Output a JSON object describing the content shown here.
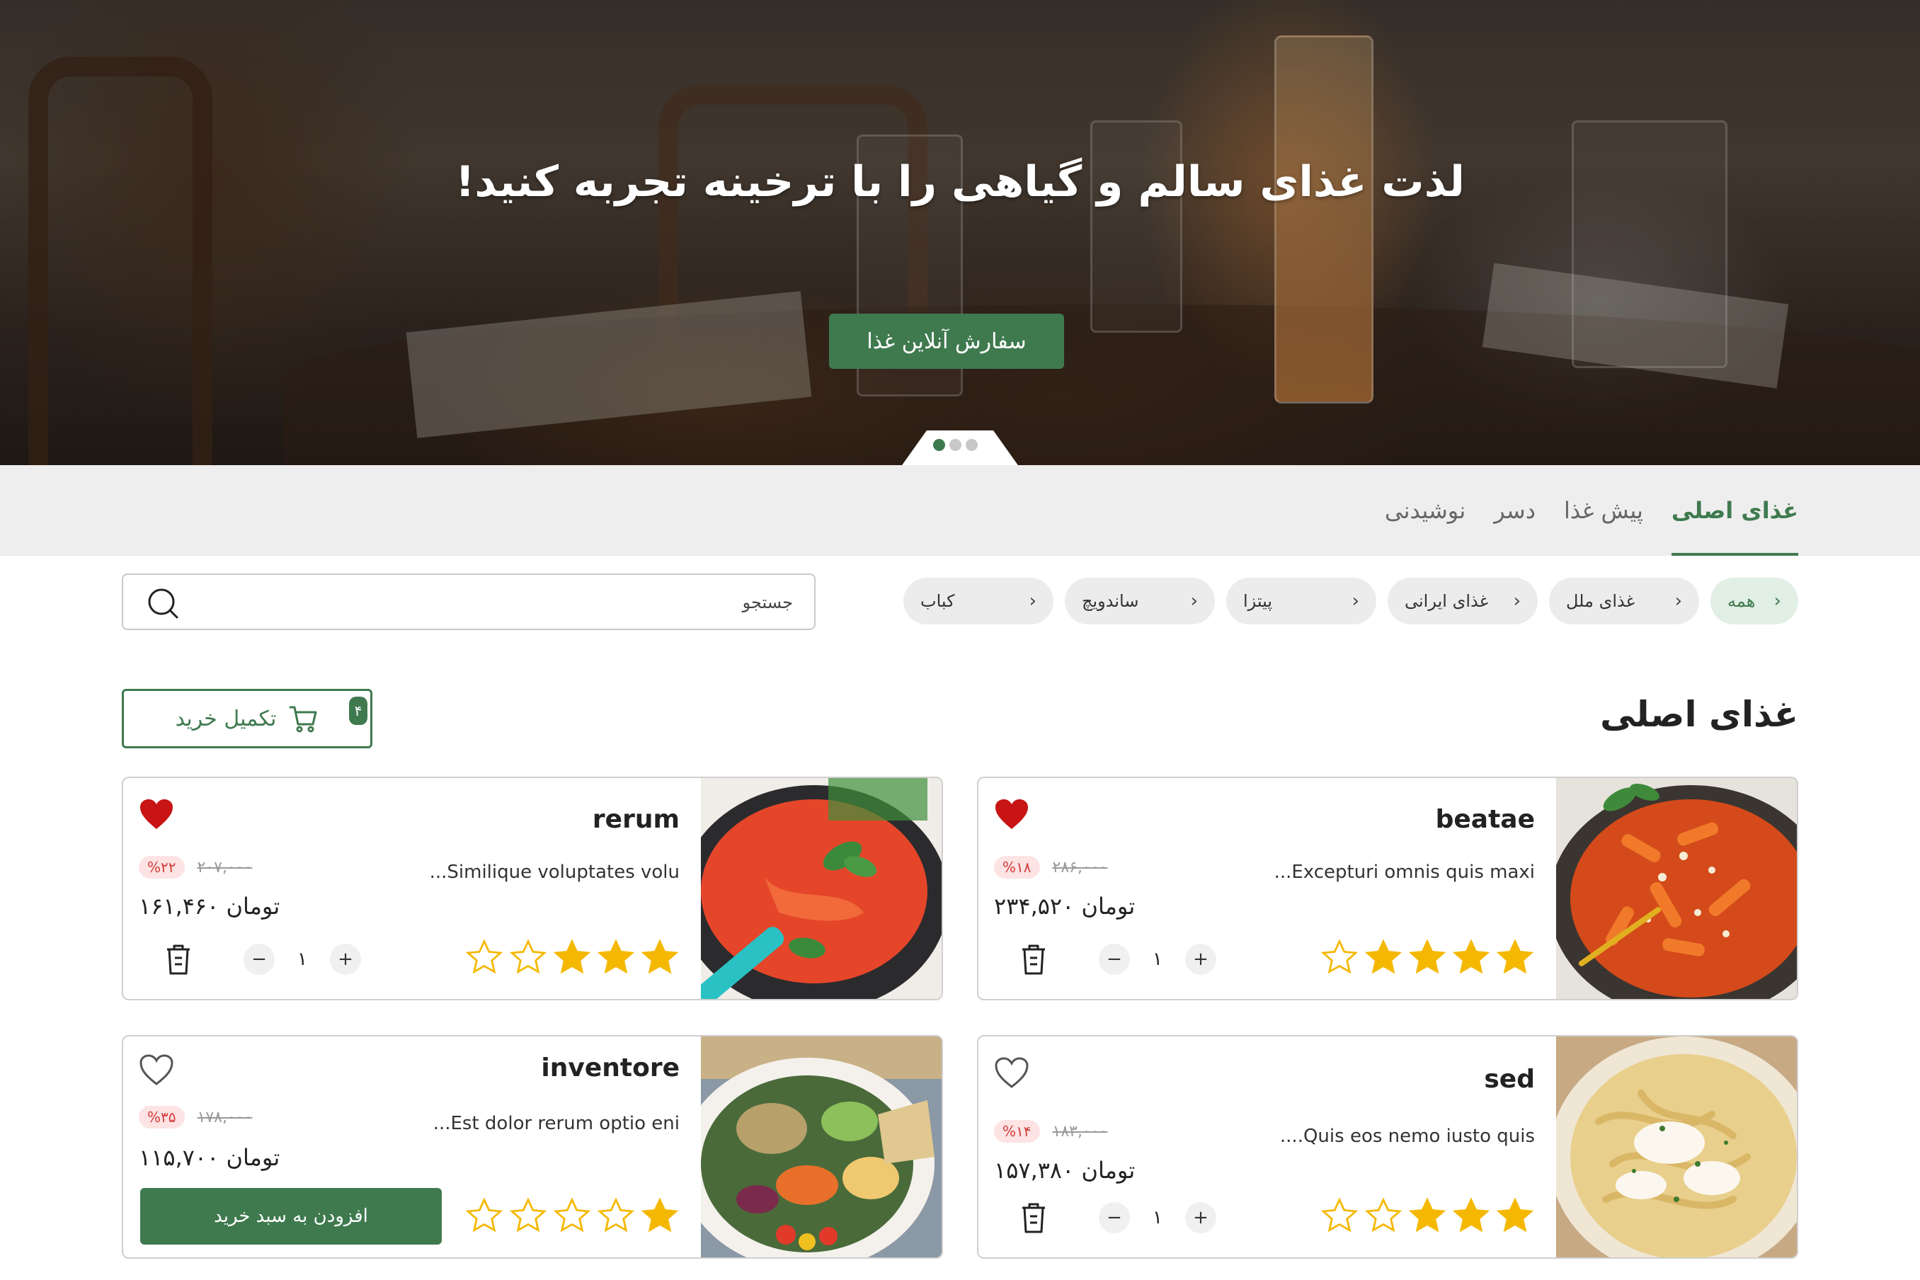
{
  "hero": {
    "title": "لذت غذای سالم و گیاهی را با ترخینه تجربه کنید!",
    "cta_label": "سفارش آنلاین غذا",
    "slide_count": 3,
    "active_slide": 1
  },
  "tabs": [
    {
      "label": "غذای اصلی",
      "active": true
    },
    {
      "label": "پیش غذا",
      "active": false
    },
    {
      "label": "دسر",
      "active": false
    },
    {
      "label": "نوشیدنی",
      "active": false
    }
  ],
  "categories": [
    {
      "label": "همه",
      "active": true
    },
    {
      "label": "غذای ملل",
      "active": false
    },
    {
      "label": "غذای ایرانی",
      "active": false
    },
    {
      "label": "پیتزا",
      "active": false
    },
    {
      "label": "ساندویچ",
      "active": false
    },
    {
      "label": "کباب",
      "active": false
    }
  ],
  "search": {
    "placeholder": "جستجو"
  },
  "section": {
    "title": "غذای اصلی"
  },
  "checkout": {
    "label": "تکمیل خرید",
    "badge": "۴"
  },
  "colors": {
    "brand": "#3f7a4f",
    "star": "#f5b800",
    "heart": "#c81414",
    "discount": "#d23b3b"
  },
  "products": [
    {
      "name": "beatae",
      "description": "...Excepturi omnis quis maxi",
      "discount": "%۱۸",
      "old_price": "۲۸۶,۰۰۰",
      "price": "۲۳۴,۵۲۰",
      "currency": "تومان",
      "rating": 4,
      "favorite": true,
      "in_cart": true,
      "quantity": "۱",
      "image": "fusilli-pasta-bowl"
    },
    {
      "name": "rerum",
      "description": "...Similique voluptates volu",
      "discount": "%۲۲",
      "old_price": "۲۰۷,۰۰۰",
      "price": "۱۶۱,۴۶۰",
      "currency": "تومان",
      "rating": 3,
      "favorite": true,
      "in_cart": true,
      "quantity": "۱",
      "image": "tomato-soup-pan"
    },
    {
      "name": "sed",
      "description": "....Quis eos nemo iusto quis",
      "discount": "%۱۴",
      "old_price": "۱۸۳,۰۰۰",
      "price": "۱۵۷,۳۸۰",
      "currency": "تومان",
      "rating": 3,
      "favorite": false,
      "in_cart": true,
      "quantity": "۱",
      "image": "creamy-fettuccine"
    },
    {
      "name": "inventore",
      "description": "...Est dolor rerum optio eni",
      "discount": "%۳۵",
      "old_price": "۱۷۸,۰۰۰",
      "price": "۱۱۵,۷۰۰",
      "currency": "تومان",
      "rating": 1,
      "favorite": false,
      "in_cart": false,
      "add_to_cart_label": "افزودن به سبد خرید",
      "image": "mediterranean-salad"
    }
  ]
}
